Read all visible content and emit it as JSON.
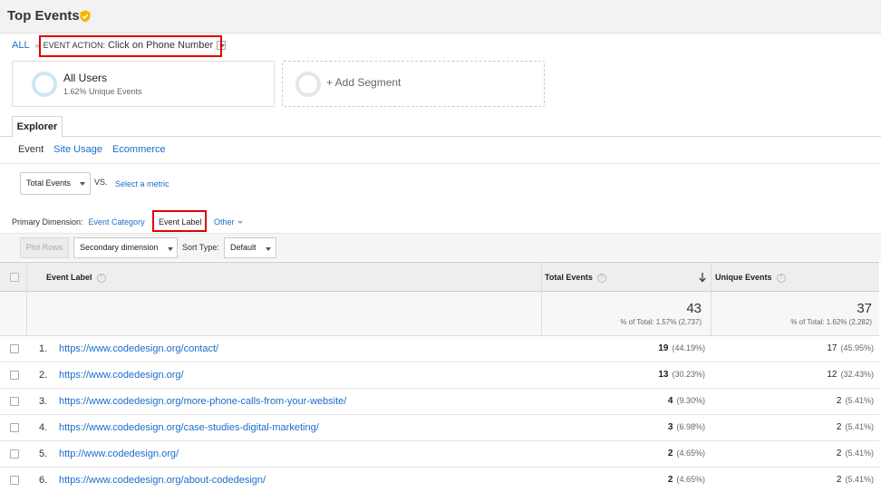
{
  "header": {
    "title": "Top Events"
  },
  "breadcrumb": {
    "all": "ALL",
    "separator": "»",
    "action_key": "EVENT ACTION:",
    "action_value": "Click on Phone Number"
  },
  "segments": [
    {
      "name": "All Users",
      "sub": "1.62% Unique Events"
    },
    {
      "name": "+ Add Segment"
    }
  ],
  "tabs": {
    "explorer": "Explorer"
  },
  "subtabs": [
    "Event",
    "Site Usage",
    "Ecommerce"
  ],
  "metric": {
    "selected": "Total Events",
    "vs": "VS.",
    "select_metric": "Select a metric"
  },
  "primary_dimension": {
    "label": "Primary Dimension:",
    "options": [
      "Event Category",
      "Event Label",
      "Other"
    ]
  },
  "toolbar": {
    "plot_rows": "Plot Rows",
    "secondary_dimension": "Secondary dimension",
    "sort_type_label": "Sort Type:",
    "sort_type_value": "Default"
  },
  "table": {
    "columns": [
      "Event Label",
      "Total Events",
      "Unique Events"
    ],
    "totals": {
      "total_events": "43",
      "total_events_sub": "% of Total: 1.57% (2,737)",
      "unique_events": "37",
      "unique_events_sub": "% of Total: 1.62% (2,282)"
    },
    "rows": [
      {
        "num": "1.",
        "label": "https://www.codedesign.org/contact/",
        "te": "19",
        "te_pct": "(44.19%)",
        "ue": "17",
        "ue_pct": "(45.95%)"
      },
      {
        "num": "2.",
        "label": "https://www.codedesign.org/",
        "te": "13",
        "te_pct": "(30.23%)",
        "ue": "12",
        "ue_pct": "(32.43%)"
      },
      {
        "num": "3.",
        "label": "https://www.codedesign.org/more-phone-calls-from-your-website/",
        "te": "4",
        "te_pct": "(9.30%)",
        "ue": "2",
        "ue_pct": "(5.41%)"
      },
      {
        "num": "4.",
        "label": "https://www.codedesign.org/case-studies-digital-marketing/",
        "te": "3",
        "te_pct": "(6.98%)",
        "ue": "2",
        "ue_pct": "(5.41%)"
      },
      {
        "num": "5.",
        "label": "http://www.codedesign.org/",
        "te": "2",
        "te_pct": "(4.65%)",
        "ue": "2",
        "ue_pct": "(5.41%)"
      },
      {
        "num": "6.",
        "label": "https://www.codedesign.org/about-codedesign/",
        "te": "2",
        "te_pct": "(4.65%)",
        "ue": "2",
        "ue_pct": "(5.41%)"
      }
    ]
  },
  "colors": {
    "link": "#1a6dcc",
    "highlight_box": "#e00000",
    "verified": "#f4b400"
  },
  "icons": {
    "verified": "verified-badge-icon",
    "help": "help-icon",
    "sort": "arrow-down-icon"
  }
}
